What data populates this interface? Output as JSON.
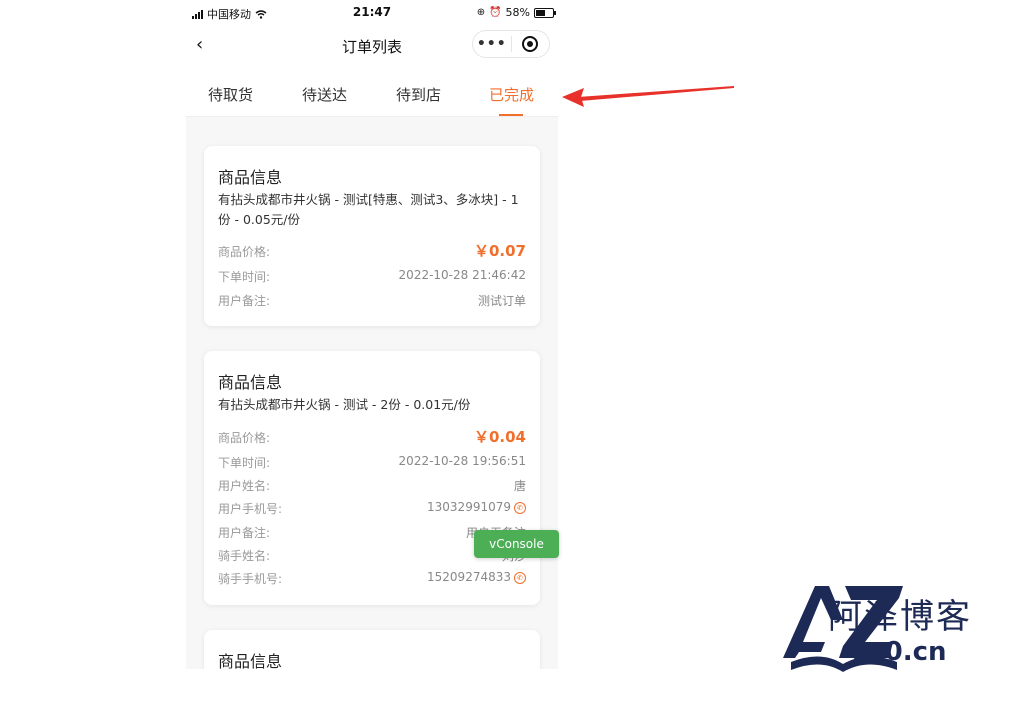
{
  "status_bar": {
    "carrier": "中国移动",
    "time": "21:47",
    "battery": "58%"
  },
  "nav": {
    "title": "订单列表"
  },
  "tabs": [
    {
      "label": "待取货"
    },
    {
      "label": "待送达"
    },
    {
      "label": "待到店"
    },
    {
      "label": "已完成",
      "active": true
    }
  ],
  "orders": [
    {
      "title": "商品信息",
      "desc": "有拈头成都市井火锅 - 测试[特惠、测试3、多冰块] - 1份 - 0.05元/份",
      "rows": [
        {
          "label": "商品价格:",
          "value": "￥0.07"
        },
        {
          "label": "下单时间:",
          "value": "2022-10-28 21:46:42"
        },
        {
          "label": "用户备注:",
          "value": "测试订单"
        }
      ]
    },
    {
      "title": "商品信息",
      "desc": "有拈头成都市井火锅 - 测试 - 2份 - 0.01元/份",
      "rows": [
        {
          "label": "商品价格:",
          "value": "￥0.04"
        },
        {
          "label": "下单时间:",
          "value": "2022-10-28 19:56:51"
        },
        {
          "label": "用户姓名:",
          "value": "唐"
        },
        {
          "label": "用户手机号:",
          "value": "13032991079"
        },
        {
          "label": "用户备注:",
          "value": "用户无备注"
        },
        {
          "label": "骑手姓名:",
          "value": "刘莎"
        },
        {
          "label": "骑手手机号:",
          "value": "15209274833"
        }
      ]
    },
    {
      "title": "商品信息"
    }
  ],
  "vconsole_label": "vConsole",
  "watermark": {
    "name": "阿泽博客",
    "url": "az0.cn",
    "mark": "AZ"
  },
  "colors": {
    "accent": "#f06f2c",
    "vconsole": "#4cae55",
    "arrow": "#e8312a",
    "logo": "#1d2a55"
  }
}
